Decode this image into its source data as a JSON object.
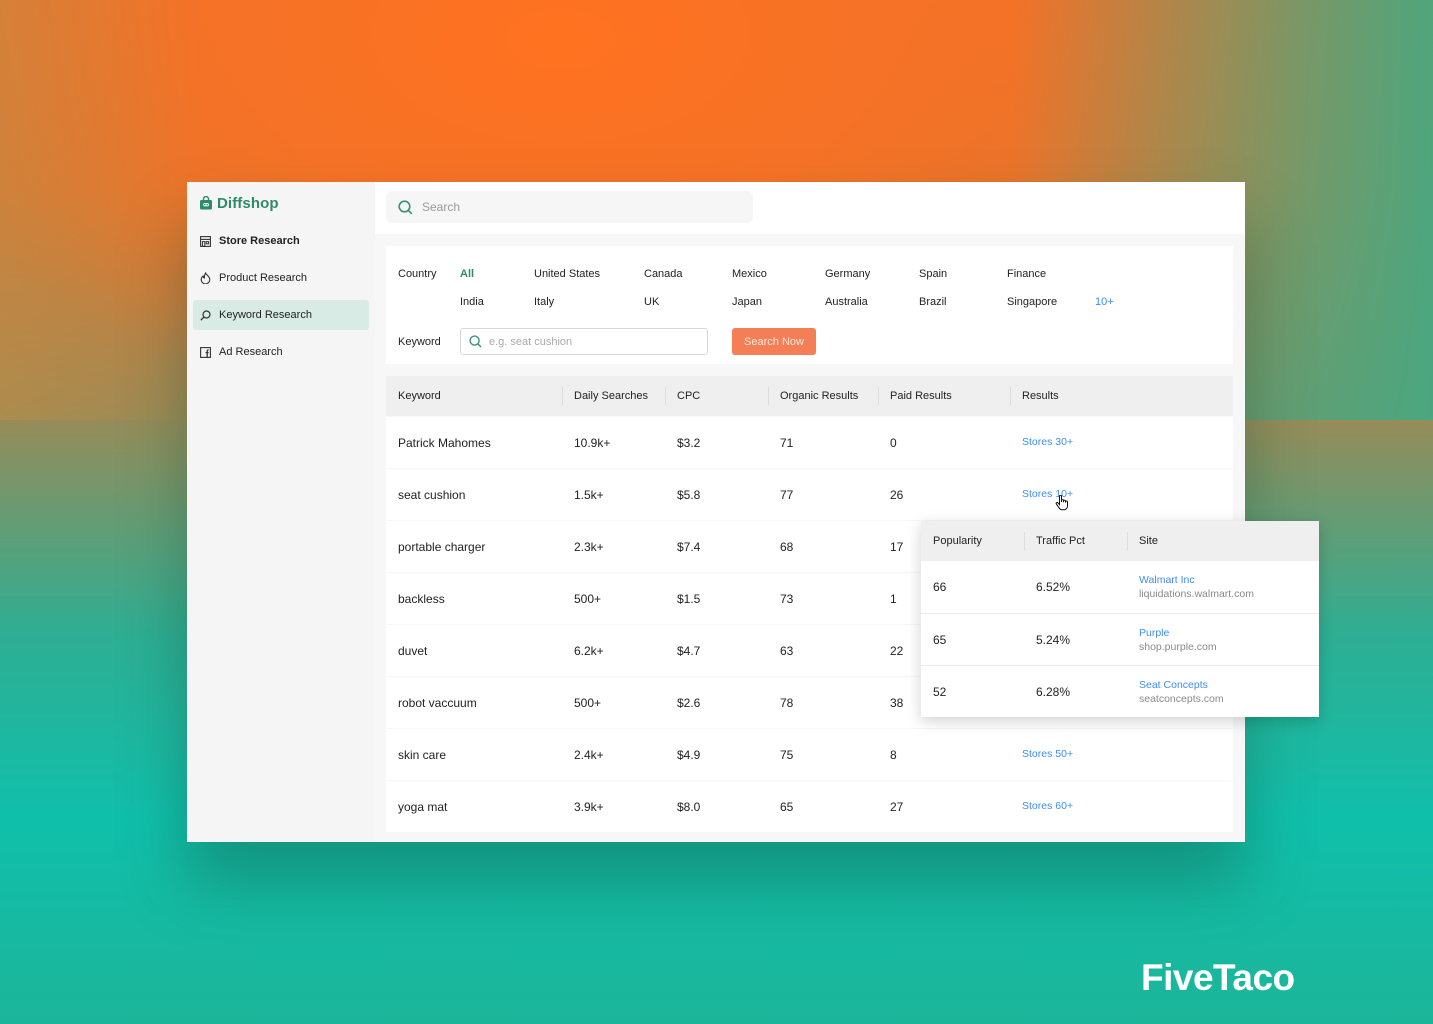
{
  "app": {
    "name": "Diffshop",
    "brand_color": "#2e8b67",
    "accent_button_color": "#f47e55",
    "link_color": "#3d8ef0"
  },
  "sidebar": {
    "items": [
      {
        "label": "Store Research",
        "icon": "store-icon",
        "active": false
      },
      {
        "label": "Product Research",
        "icon": "flame-icon",
        "active": false
      },
      {
        "label": "Keyword Research",
        "icon": "search-icon",
        "active": true
      },
      {
        "label": "Ad Research",
        "icon": "facebook-icon",
        "active": false
      }
    ]
  },
  "topbar": {
    "search_placeholder": "Search"
  },
  "filters": {
    "country_label": "Country",
    "countries_row1": [
      "All",
      "United States",
      "Canada",
      "Mexico",
      "Germany",
      "Spain",
      "Finance"
    ],
    "countries_row2": [
      "India",
      "Italy",
      "UK",
      "Japan",
      "Australia",
      "Brazil",
      "Singapore"
    ],
    "more_label": "10+",
    "selected_country": "All",
    "keyword_label": "Keyword",
    "keyword_placeholder": "e.g. seat cushion",
    "keyword_value": "",
    "search_button": "Search Now"
  },
  "table": {
    "headers": [
      "Keyword",
      "Daily Searches",
      "CPC",
      "Organic Results",
      "Paid Results",
      "Results"
    ],
    "rows": [
      {
        "keyword": "Patrick Mahomes",
        "daily": "10.9k+",
        "cpc": "$3.2",
        "organic": "71",
        "paid": "0",
        "results": "Stores 30+"
      },
      {
        "keyword": "seat cushion",
        "daily": "1.5k+",
        "cpc": "$5.8",
        "organic": "77",
        "paid": "26",
        "results": "Stores 10+"
      },
      {
        "keyword": "portable charger",
        "daily": "2.3k+",
        "cpc": "$7.4",
        "organic": "68",
        "paid": "17",
        "results": ""
      },
      {
        "keyword": "backless",
        "daily": "500+",
        "cpc": "$1.5",
        "organic": "73",
        "paid": "1",
        "results": ""
      },
      {
        "keyword": "duvet",
        "daily": "6.2k+",
        "cpc": "$4.7",
        "organic": "63",
        "paid": "22",
        "results": ""
      },
      {
        "keyword": "robot vaccuum",
        "daily": "500+",
        "cpc": "$2.6",
        "organic": "78",
        "paid": "38",
        "results": ""
      },
      {
        "keyword": "skin care",
        "daily": "2.4k+",
        "cpc": "$4.9",
        "organic": "75",
        "paid": "8",
        "results": "Stores 50+"
      },
      {
        "keyword": "yoga mat",
        "daily": "3.9k+",
        "cpc": "$8.0",
        "organic": "65",
        "paid": "27",
        "results": "Stores 60+"
      }
    ]
  },
  "popup": {
    "headers": [
      "Popularity",
      "Traffic Pct",
      "Site"
    ],
    "rows": [
      {
        "popularity": "66",
        "traffic": "6.52%",
        "site_name": "Walmart Inc",
        "site_url": "liquidations.walmart.com"
      },
      {
        "popularity": "65",
        "traffic": "5.24%",
        "site_name": "Purple",
        "site_url": "shop.purple.com"
      },
      {
        "popularity": "52",
        "traffic": "6.28%",
        "site_name": "Seat Concepts",
        "site_url": "seatconcepts.com"
      }
    ]
  },
  "watermark": "FiveTaco"
}
